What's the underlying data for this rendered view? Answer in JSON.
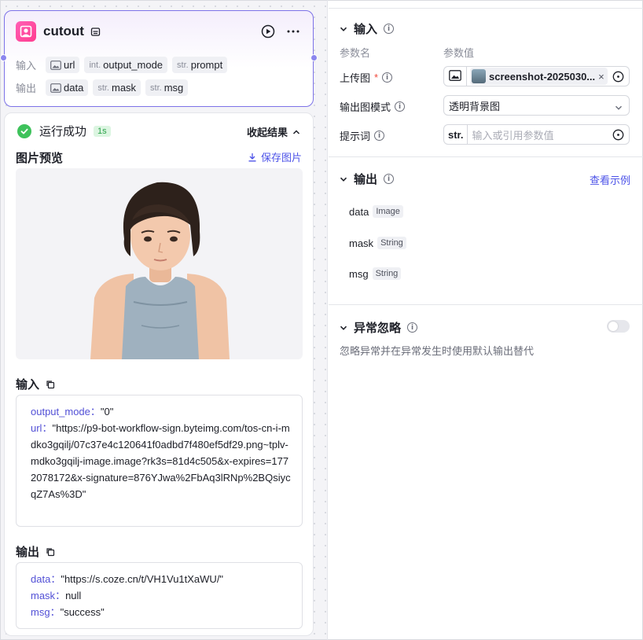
{
  "node": {
    "title": "cutout",
    "input_label": "输入",
    "output_label": "输出",
    "inputs": [
      {
        "prefix": "",
        "name": "url",
        "type_icon": "image-icon"
      },
      {
        "prefix": "int.",
        "name": "output_mode"
      },
      {
        "prefix": "str.",
        "name": "prompt"
      }
    ],
    "outputs": [
      {
        "prefix": "",
        "name": "data",
        "type_icon": "image-icon"
      },
      {
        "prefix": "str.",
        "name": "mask"
      },
      {
        "prefix": "str.",
        "name": "msg"
      }
    ]
  },
  "result": {
    "status": "运行成功",
    "duration": "1s",
    "collapse_label": "收起结果",
    "preview_title": "图片预览",
    "save_label": "保存图片",
    "input_title": "输入",
    "input_lines": [
      {
        "key": "output_mode",
        "value": "\"0\""
      },
      {
        "key": "url",
        "value": "\"https://p9-bot-workflow-sign.byteimg.com/tos-cn-i-mdko3gqilj/07c37e4c120641f0adbd7f480ef5df29.png~tplv-mdko3gqilj-image.image?rk3s=81d4c505&x-expires=1772078172&x-signature=876YJwa%2FbAq3lRNp%2BQsiycqZ7As%3D\""
      }
    ],
    "output_title": "输出",
    "output_lines": [
      {
        "key": "data",
        "value": "\"https://s.coze.cn/t/VH1Vu1tXaWU/\""
      },
      {
        "key": "mask",
        "value": "null"
      },
      {
        "key": "msg",
        "value": "\"success\""
      }
    ],
    "sep": "："
  },
  "panel": {
    "input_section": "输入",
    "col_name": "参数名",
    "col_value": "参数值",
    "params": {
      "upload": {
        "label": "上传图",
        "required": "*",
        "file_name": "screenshot-2025030..."
      },
      "mode": {
        "label": "输出图模式",
        "value": "透明背景图"
      },
      "prompt": {
        "label": "提示词",
        "type": "str.",
        "placeholder": "输入或引用参数值"
      }
    },
    "output_section": "输出",
    "view_example": "查看示例",
    "outputs": [
      {
        "name": "data",
        "type": "Image"
      },
      {
        "name": "mask",
        "type": "String"
      },
      {
        "name": "msg",
        "type": "String"
      }
    ],
    "exception_section": "异常忽略",
    "exception_enabled": false,
    "exception_desc": "忽略异常并在异常发生时使用默认输出替代"
  },
  "colors": {
    "accent": "#4d53e8",
    "success": "#3ec25b",
    "node_border": "#7d73e8",
    "required": "#f0483b"
  }
}
